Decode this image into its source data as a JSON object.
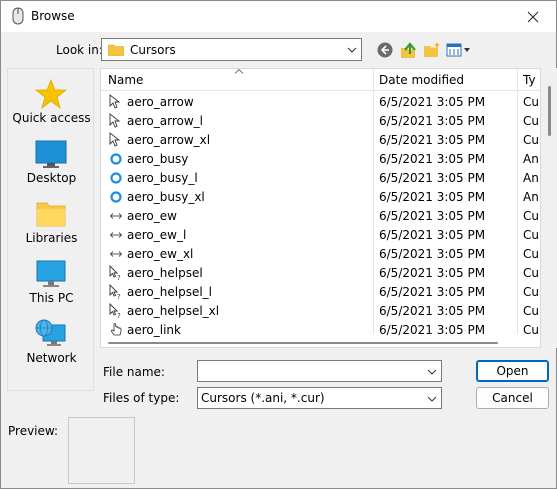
{
  "window": {
    "title": "Browse"
  },
  "look_in": {
    "label": "Look in:",
    "value": "Cursors"
  },
  "toolbar": {
    "back_icon": "back-arrow-icon",
    "up_icon": "up-folder-icon",
    "new_folder_icon": "new-folder-icon",
    "view_menu_icon": "view-menu-icon"
  },
  "places": [
    {
      "label": "Quick access",
      "icon": "star-icon"
    },
    {
      "label": "Desktop",
      "icon": "desktop-icon"
    },
    {
      "label": "Libraries",
      "icon": "libraries-folder-icon"
    },
    {
      "label": "This PC",
      "icon": "pc-monitor-icon"
    },
    {
      "label": "Network",
      "icon": "network-icon"
    }
  ],
  "columns": {
    "name": "Name",
    "date": "Date modified",
    "type": "Ty"
  },
  "files": [
    {
      "name": "aero_arrow",
      "date": "6/5/2021 3:05 PM",
      "type": "Cu",
      "icon": "arrow"
    },
    {
      "name": "aero_arrow_l",
      "date": "6/5/2021 3:05 PM",
      "type": "Cu",
      "icon": "arrow"
    },
    {
      "name": "aero_arrow_xl",
      "date": "6/5/2021 3:05 PM",
      "type": "Cu",
      "icon": "arrow"
    },
    {
      "name": "aero_busy",
      "date": "6/5/2021 3:05 PM",
      "type": "An",
      "icon": "busy"
    },
    {
      "name": "aero_busy_l",
      "date": "6/5/2021 3:05 PM",
      "type": "An",
      "icon": "busy"
    },
    {
      "name": "aero_busy_xl",
      "date": "6/5/2021 3:05 PM",
      "type": "An",
      "icon": "busy"
    },
    {
      "name": "aero_ew",
      "date": "6/5/2021 3:05 PM",
      "type": "Cu",
      "icon": "ew"
    },
    {
      "name": "aero_ew_l",
      "date": "6/5/2021 3:05 PM",
      "type": "Cu",
      "icon": "ew"
    },
    {
      "name": "aero_ew_xl",
      "date": "6/5/2021 3:05 PM",
      "type": "Cu",
      "icon": "ew"
    },
    {
      "name": "aero_helpsel",
      "date": "6/5/2021 3:05 PM",
      "type": "Cu",
      "icon": "help"
    },
    {
      "name": "aero_helpsel_l",
      "date": "6/5/2021 3:05 PM",
      "type": "Cu",
      "icon": "help"
    },
    {
      "name": "aero_helpsel_xl",
      "date": "6/5/2021 3:05 PM",
      "type": "Cu",
      "icon": "help"
    },
    {
      "name": "aero_link",
      "date": "6/5/2021 3:05 PM",
      "type": "Cu",
      "icon": "link"
    }
  ],
  "filename": {
    "label": "File name:",
    "value": ""
  },
  "filetype": {
    "label": "Files of type:",
    "value": "Cursors (*.ani, *.cur)"
  },
  "buttons": {
    "open": "Open",
    "cancel": "Cancel"
  },
  "preview": {
    "label": "Preview:"
  },
  "colors": {
    "accent": "#0067c0",
    "folder": "#f5c342",
    "busy_ring": "#1e8fe0"
  }
}
